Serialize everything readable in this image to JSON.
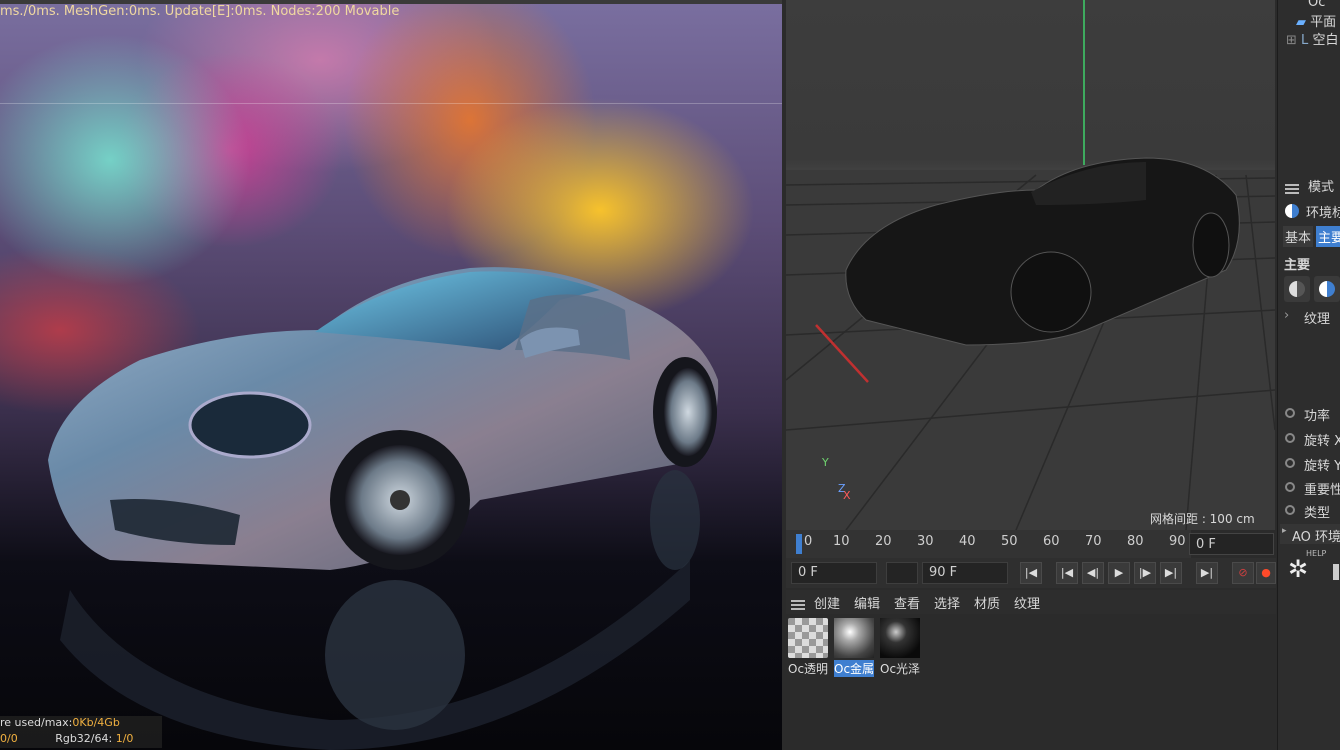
{
  "render_view": {
    "stats_top": "ms./0ms. MeshGen:0ms. Update[E]:0ms. Nodes:200 Movable",
    "stats_bottom_1_label": "re used/max:",
    "stats_bottom_1_value": "0Kb/4Gb",
    "stats_bottom_2_left": "0/0",
    "stats_bottom_2_label": "Rgb32/64:",
    "stats_bottom_2_value": "1/0"
  },
  "viewport": {
    "grid_caption": "网格间距 : 100 cm",
    "axis_y": "Y",
    "axis_z": "Z",
    "axis_x": "X"
  },
  "timeline": {
    "ticks": [
      "0",
      "10",
      "20",
      "30",
      "40",
      "50",
      "60",
      "70",
      "80",
      "90"
    ],
    "current_frame": "0 F",
    "start_frame": "0 F",
    "end_frame": "90 F"
  },
  "material_manager": {
    "menu": [
      "创建",
      "编辑",
      "查看",
      "选择",
      "材质",
      "纹理"
    ],
    "materials": [
      {
        "label": "Oc透明",
        "selected": false
      },
      {
        "label": "Oc金属",
        "selected": true
      },
      {
        "label": "Oc光泽",
        "selected": false
      }
    ]
  },
  "object_manager": {
    "items": [
      "Oc",
      "平面",
      "空白"
    ]
  },
  "attributes": {
    "menu_label": "模式",
    "object_name": "环境标",
    "tab_basic": "基本",
    "tab_main": "主要",
    "section_main": "主要",
    "texture_label": "纹理",
    "params": [
      "功率",
      "旋转 X",
      "旋转 Y",
      "重要性",
      "类型"
    ],
    "ao_label": "AO 环境",
    "help_label": "HELP"
  },
  "colors": {
    "accent_blue": "#3f7fd0",
    "stats_orange": "#f0b040",
    "grid_green": "#3fcf6a"
  }
}
